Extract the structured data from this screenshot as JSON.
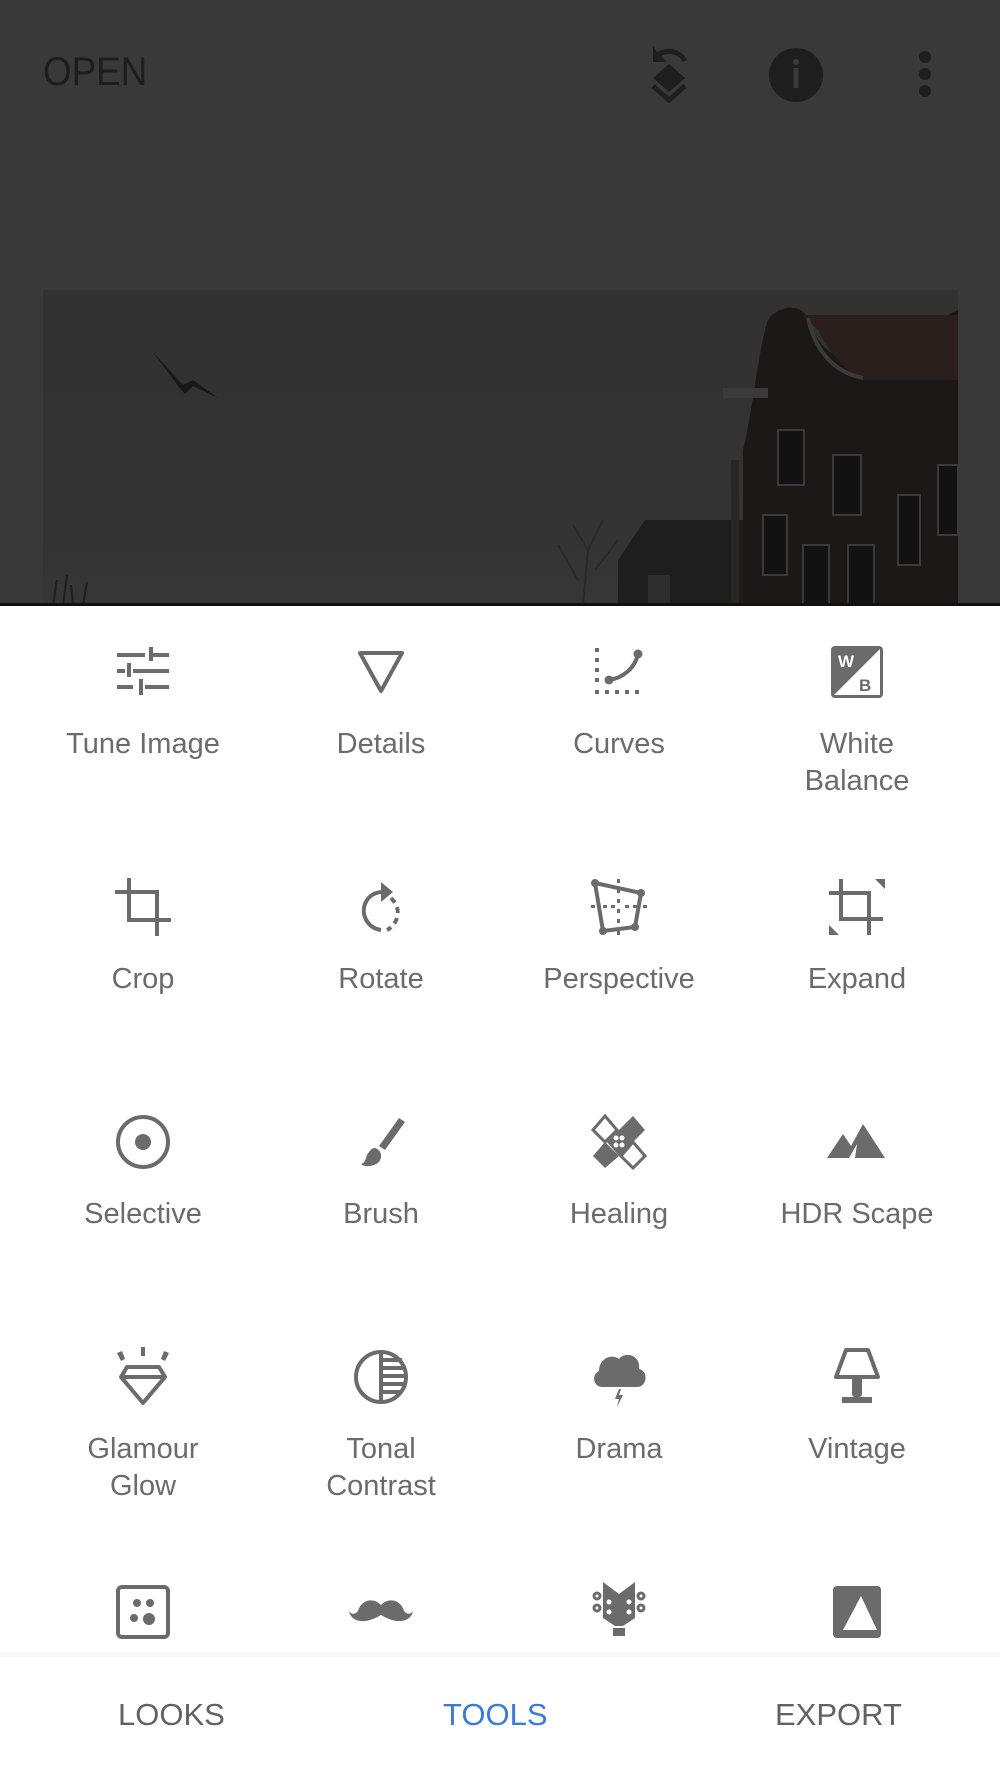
{
  "header": {
    "open_label": "OPEN",
    "icons": [
      "undo-layers-icon",
      "info-icon",
      "more-vert-icon"
    ]
  },
  "photo": {
    "description": "Dimmed photo of gabled canal houses with a bird in flight"
  },
  "tools": [
    {
      "label": "Tune Image",
      "icon": "tune-sliders-icon"
    },
    {
      "label": "Details",
      "icon": "details-triangle-icon"
    },
    {
      "label": "Curves",
      "icon": "curves-icon"
    },
    {
      "label": "White\nBalance",
      "icon": "white-balance-icon"
    },
    {
      "label": "Crop",
      "icon": "crop-icon"
    },
    {
      "label": "Rotate",
      "icon": "rotate-icon"
    },
    {
      "label": "Perspective",
      "icon": "perspective-icon"
    },
    {
      "label": "Expand",
      "icon": "expand-icon"
    },
    {
      "label": "Selective",
      "icon": "selective-icon"
    },
    {
      "label": "Brush",
      "icon": "brush-icon"
    },
    {
      "label": "Healing",
      "icon": "healing-icon"
    },
    {
      "label": "HDR Scape",
      "icon": "mountain-icon"
    },
    {
      "label": "Glamour\nGlow",
      "icon": "diamond-glow-icon"
    },
    {
      "label": "Tonal\nContrast",
      "icon": "tonal-contrast-icon"
    },
    {
      "label": "Drama",
      "icon": "storm-cloud-icon"
    },
    {
      "label": "Vintage",
      "icon": "lamp-icon"
    },
    {
      "label": "",
      "icon": "grainy-film-icon"
    },
    {
      "label": "",
      "icon": "mustache-icon"
    },
    {
      "label": "",
      "icon": "guitar-head-icon"
    },
    {
      "label": "",
      "icon": "frame-icon"
    }
  ],
  "bottom_nav": {
    "items": [
      {
        "label": "LOOKS",
        "active": false
      },
      {
        "label": "TOOLS",
        "active": true
      },
      {
        "label": "EXPORT",
        "active": false
      }
    ],
    "active_color": "#3a7ad9"
  },
  "colors": {
    "overlay": "#393939",
    "icon_gray": "#6b6b6b",
    "accent": "#3a7ad9"
  }
}
